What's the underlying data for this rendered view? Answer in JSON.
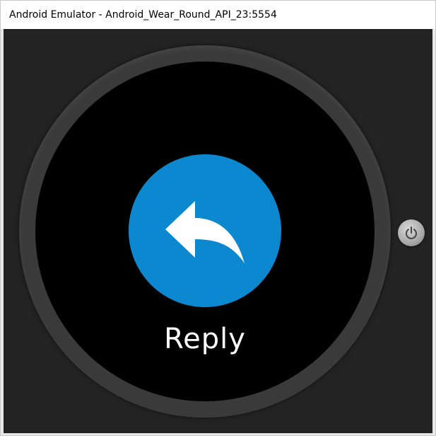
{
  "window": {
    "title": "Android Emulator - Android_Wear_Round_API_23:5554"
  },
  "watch": {
    "action": {
      "label": "Reply",
      "icon": "reply-arrow-icon",
      "color": "#0b88d0"
    },
    "power_button": {
      "icon": "power-icon"
    }
  },
  "colors": {
    "screen": "#000000",
    "bezel": "#3a3a3a",
    "window_background": "#232323"
  }
}
